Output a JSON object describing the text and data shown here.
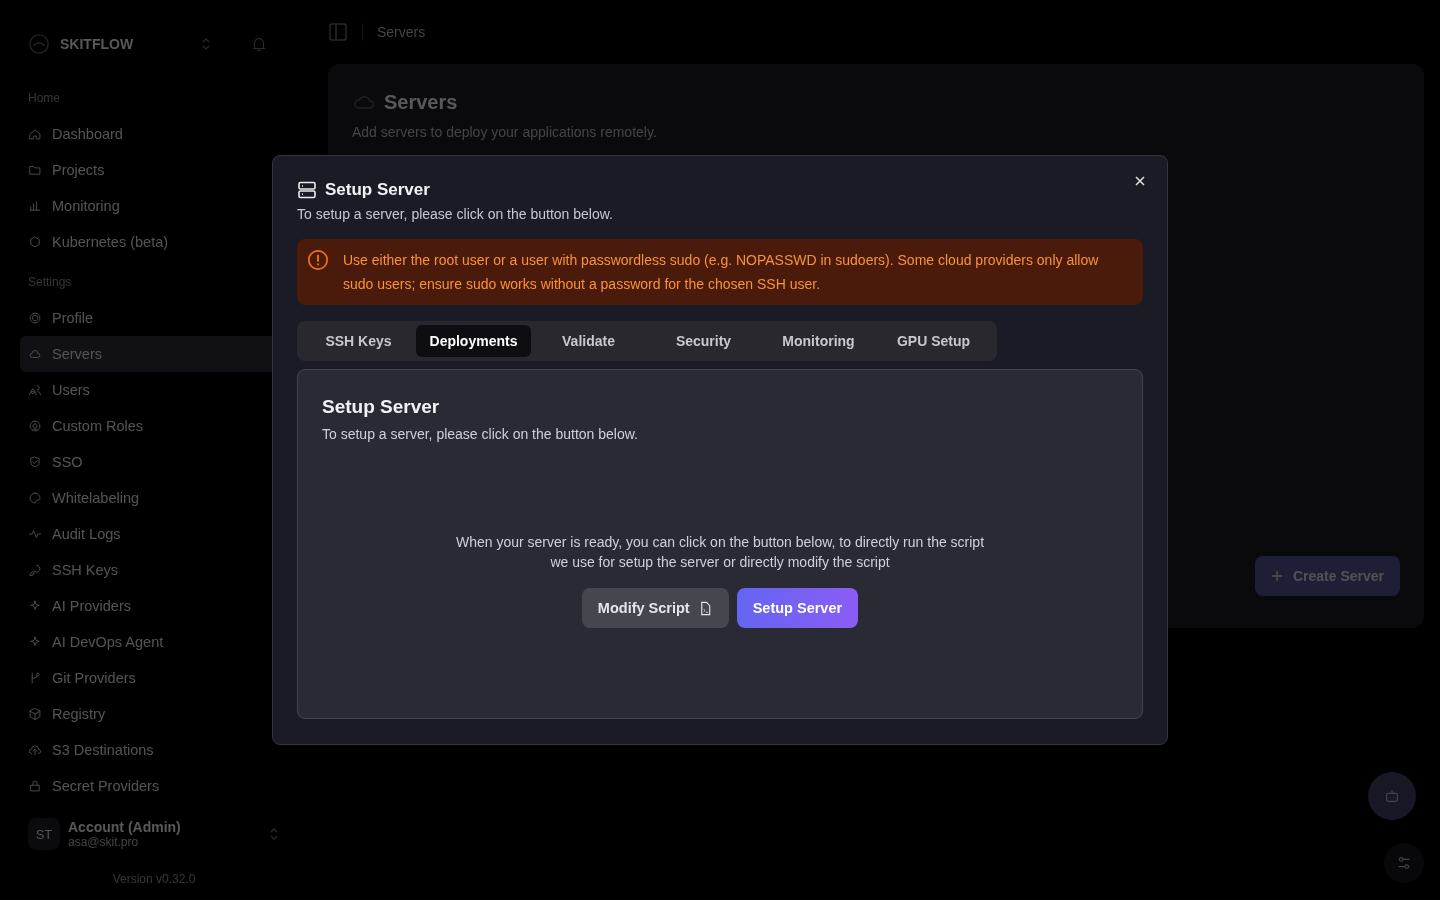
{
  "sidebar": {
    "brand": "SKITFLOW",
    "groups": [
      {
        "label": "Home",
        "items": [
          {
            "label": "Dashboard",
            "selected": false
          },
          {
            "label": "Projects",
            "selected": false
          },
          {
            "label": "Monitoring",
            "selected": false
          },
          {
            "label": "Kubernetes (beta)",
            "selected": false
          }
        ]
      },
      {
        "label": "Settings",
        "items": [
          {
            "label": "Profile",
            "selected": false
          },
          {
            "label": "Servers",
            "selected": true
          },
          {
            "label": "Users",
            "selected": false
          },
          {
            "label": "Custom Roles",
            "selected": false
          },
          {
            "label": "SSO",
            "selected": false
          },
          {
            "label": "Whitelabeling",
            "selected": false
          },
          {
            "label": "Audit Logs",
            "selected": false
          },
          {
            "label": "SSH Keys",
            "selected": false
          },
          {
            "label": "AI Providers",
            "selected": false
          },
          {
            "label": "AI DevOps Agent",
            "selected": false
          },
          {
            "label": "Git Providers",
            "selected": false
          },
          {
            "label": "Registry",
            "selected": false
          },
          {
            "label": "S3 Destinations",
            "selected": false
          },
          {
            "label": "Secret Providers",
            "selected": false
          }
        ]
      }
    ],
    "account": {
      "initials": "ST",
      "name": "Account (Admin)",
      "email": "asa@skit.pro"
    },
    "version": "Version v0.32.0"
  },
  "breadcrumb": "Servers",
  "page": {
    "title": "Servers",
    "subtitle": "Add servers to deploy your applications remotely.",
    "create_button": "Create Server"
  },
  "dialog": {
    "title": "Setup Server",
    "description": "To setup a server, please click on the button below.",
    "alert": "Use either the root user or a user with passwordless sudo (e.g. NOPASSWD in sudoers). Some cloud providers only allow sudo users; ensure sudo works without a password for the chosen SSH user.",
    "tabs": [
      {
        "label": "SSH Keys",
        "selected": false
      },
      {
        "label": "Deployments",
        "selected": true
      },
      {
        "label": "Validate",
        "selected": false
      },
      {
        "label": "Security",
        "selected": false
      },
      {
        "label": "Monitoring",
        "selected": false
      },
      {
        "label": "GPU Setup",
        "selected": false
      }
    ],
    "panel": {
      "title": "Setup Server",
      "description": "To setup a server, please click on the button below.",
      "info": [
        "When your server is ready, you can click on the button below, to directly run the script",
        "we use for setup the server or directly modify the script"
      ],
      "buttons": [
        {
          "label": "Modify Script",
          "kind": "secondary"
        },
        {
          "label": "Setup Server",
          "kind": "primary"
        }
      ]
    }
  }
}
